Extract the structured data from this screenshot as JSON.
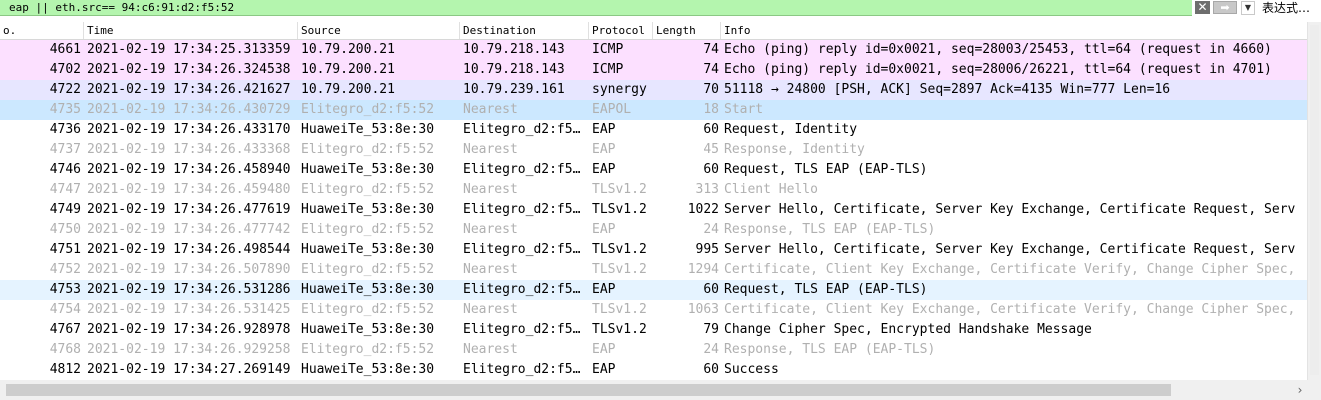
{
  "filter": {
    "text": "eap || eth.src== 94:c6:91:d2:f5:52",
    "clear_icon": "close-icon",
    "apply_icon": "arrow-right-icon",
    "dropdown_icon": "chevron-down-icon",
    "expression_label": "表达式…"
  },
  "columns": {
    "no": "o.",
    "time": "Time",
    "source": "Source",
    "destination": "Destination",
    "protocol": "Protocol",
    "length": "Length",
    "info": "Info"
  },
  "colors": {
    "icmp_bg": "#fce0ff",
    "tcp_bg": "#e7e6ff",
    "selected_bg": "#cce8ff",
    "hover_bg": "#e5f3ff",
    "dim_text": "#b0b0b0",
    "normal_text": "#000000"
  },
  "packets": [
    {
      "no": "4661",
      "time": "2021-02-19 17:34:25.313359",
      "source": "10.79.200.21",
      "destination": "10.79.218.143",
      "protocol": "ICMP",
      "length": "74",
      "info": "Echo (ping) reply    id=0x0021, seq=28003/25453, ttl=64 (request in 4660)",
      "style": "icmp"
    },
    {
      "no": "4702",
      "time": "2021-02-19 17:34:26.324538",
      "source": "10.79.200.21",
      "destination": "10.79.218.143",
      "protocol": "ICMP",
      "length": "74",
      "info": "Echo (ping) reply    id=0x0021, seq=28006/26221, ttl=64 (request in 4701)",
      "style": "icmp"
    },
    {
      "no": "4722",
      "time": "2021-02-19 17:34:26.421627",
      "source": "10.79.200.21",
      "destination": "10.79.239.161",
      "protocol": "synergy",
      "length": "70",
      "info": "51118 → 24800 [PSH, ACK] Seq=2897 Ack=4135 Win=777 Len=16",
      "style": "tcp"
    },
    {
      "no": "4735",
      "time": "2021-02-19 17:34:26.430729",
      "source": "Elitegro_d2:f5:52",
      "destination": "Nearest",
      "protocol": "EAPOL",
      "length": "18",
      "info": "Start",
      "style": "selected"
    },
    {
      "no": "4736",
      "time": "2021-02-19 17:34:26.433170",
      "source": "HuaweiTe_53:8e:30",
      "destination": "Elitegro_d2:f5…",
      "protocol": "EAP",
      "length": "60",
      "info": "Request, Identity",
      "style": "normal"
    },
    {
      "no": "4737",
      "time": "2021-02-19 17:34:26.433368",
      "source": "Elitegro_d2:f5:52",
      "destination": "Nearest",
      "protocol": "EAP",
      "length": "45",
      "info": "Response, Identity",
      "style": "dim"
    },
    {
      "no": "4746",
      "time": "2021-02-19 17:34:26.458940",
      "source": "HuaweiTe_53:8e:30",
      "destination": "Elitegro_d2:f5…",
      "protocol": "EAP",
      "length": "60",
      "info": "Request, TLS EAP (EAP-TLS)",
      "style": "normal"
    },
    {
      "no": "4747",
      "time": "2021-02-19 17:34:26.459480",
      "source": "Elitegro_d2:f5:52",
      "destination": "Nearest",
      "protocol": "TLSv1.2",
      "length": "313",
      "info": "Client Hello",
      "style": "dim"
    },
    {
      "no": "4749",
      "time": "2021-02-19 17:34:26.477619",
      "source": "HuaweiTe_53:8e:30",
      "destination": "Elitegro_d2:f5…",
      "protocol": "TLSv1.2",
      "length": "1022",
      "info": "Server Hello, Certificate, Server Key Exchange, Certificate Request, Serv",
      "style": "normal"
    },
    {
      "no": "4750",
      "time": "2021-02-19 17:34:26.477742",
      "source": "Elitegro_d2:f5:52",
      "destination": "Nearest",
      "protocol": "EAP",
      "length": "24",
      "info": "Response, TLS EAP (EAP-TLS)",
      "style": "dim"
    },
    {
      "no": "4751",
      "time": "2021-02-19 17:34:26.498544",
      "source": "HuaweiTe_53:8e:30",
      "destination": "Elitegro_d2:f5…",
      "protocol": "TLSv1.2",
      "length": "995",
      "info": "Server Hello, Certificate, Server Key Exchange, Certificate Request, Serv",
      "style": "normal"
    },
    {
      "no": "4752",
      "time": "2021-02-19 17:34:26.507890",
      "source": "Elitegro_d2:f5:52",
      "destination": "Nearest",
      "protocol": "TLSv1.2",
      "length": "1294",
      "info": "Certificate, Client Key Exchange, Certificate Verify, Change Cipher Spec,",
      "style": "dim"
    },
    {
      "no": "4753",
      "time": "2021-02-19 17:34:26.531286",
      "source": "HuaweiTe_53:8e:30",
      "destination": "Elitegro_d2:f5…",
      "protocol": "EAP",
      "length": "60",
      "info": "Request, TLS EAP (EAP-TLS)",
      "style": "hover"
    },
    {
      "no": "4754",
      "time": "2021-02-19 17:34:26.531425",
      "source": "Elitegro_d2:f5:52",
      "destination": "Nearest",
      "protocol": "TLSv1.2",
      "length": "1063",
      "info": "Certificate, Client Key Exchange, Certificate Verify, Change Cipher Spec,",
      "style": "dim"
    },
    {
      "no": "4767",
      "time": "2021-02-19 17:34:26.928978",
      "source": "HuaweiTe_53:8e:30",
      "destination": "Elitegro_d2:f5…",
      "protocol": "TLSv1.2",
      "length": "79",
      "info": "Change Cipher Spec, Encrypted Handshake Message",
      "style": "normal"
    },
    {
      "no": "4768",
      "time": "2021-02-19 17:34:26.929258",
      "source": "Elitegro_d2:f5:52",
      "destination": "Nearest",
      "protocol": "EAP",
      "length": "24",
      "info": "Response, TLS EAP (EAP-TLS)",
      "style": "dim"
    },
    {
      "no": "4812",
      "time": "2021-02-19 17:34:27.269149",
      "source": "HuaweiTe_53:8e:30",
      "destination": "Elitegro_d2:f5…",
      "protocol": "EAP",
      "length": "60",
      "info": "Success",
      "style": "normal"
    }
  ],
  "scrollbar": {
    "right_arrow_icon": "chevron-right-icon"
  }
}
